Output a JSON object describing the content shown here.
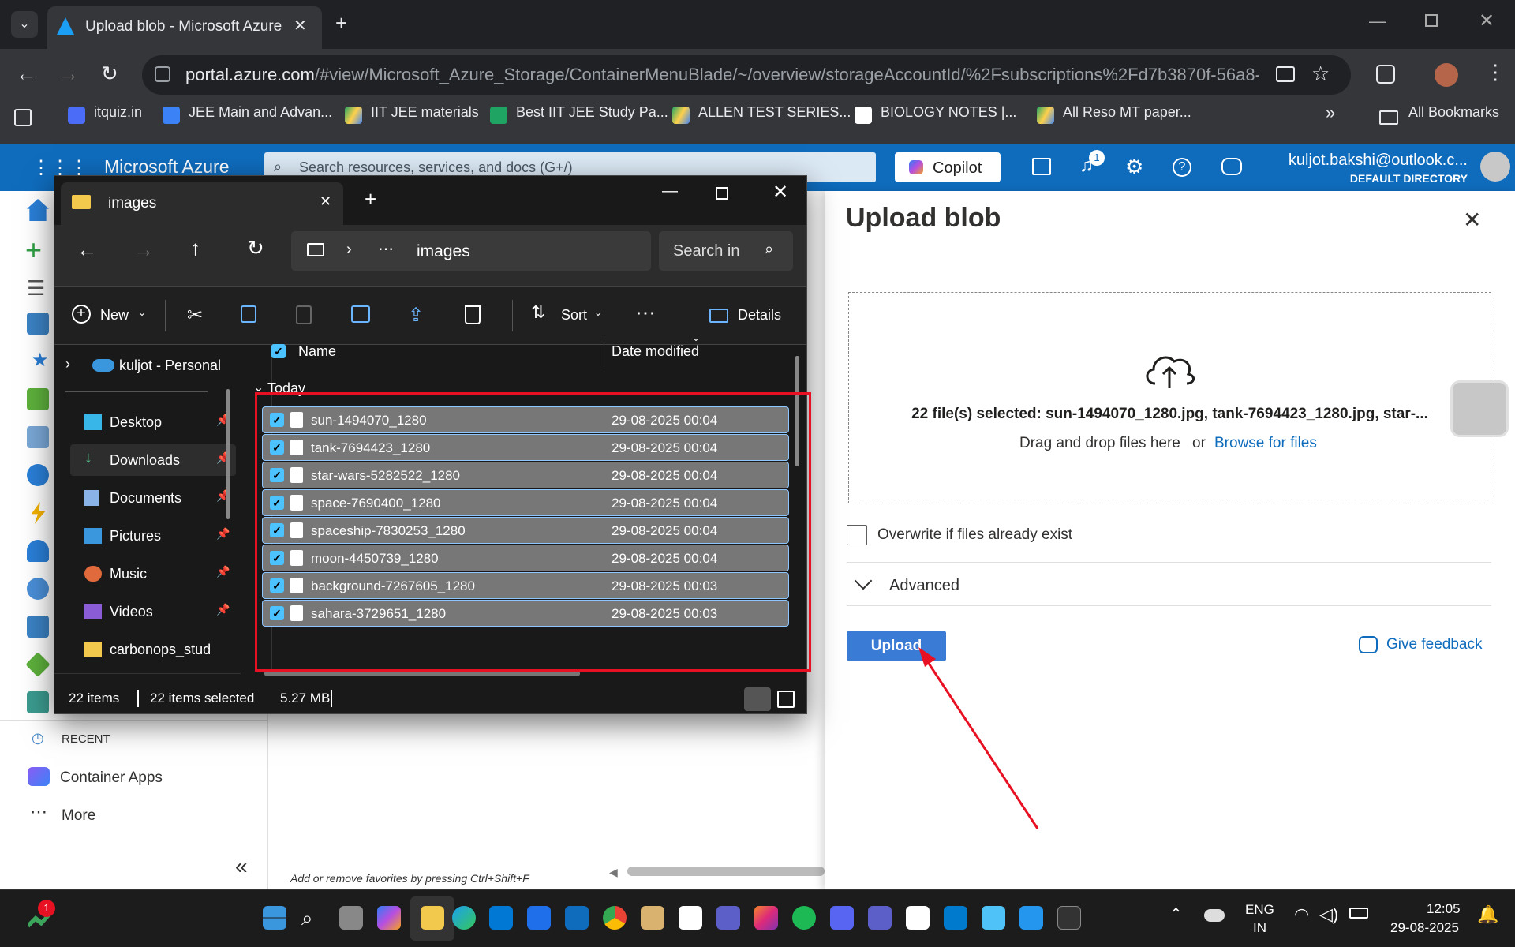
{
  "browser": {
    "tab_title": "Upload blob - Microsoft Azure",
    "url_host": "portal.azure.com",
    "url_path": "/#view/Microsoft_Azure_Storage/ContainerMenuBlade/~/overview/storageAccountId/%2Fsubscriptions%2Fd7b3870f-56a8-4d3b...",
    "bookmarks": [
      "itquiz.in",
      "JEE Main and Advan...",
      "IIT JEE materials",
      "Best IIT JEE Study Pa...",
      "ALLEN TEST SERIES...",
      "BIOLOGY NOTES |...",
      "All Reso MT paper..."
    ],
    "all_bookmarks": "All Bookmarks"
  },
  "azure": {
    "brand": "Microsoft Azure",
    "search_placeholder": "Search resources, services, and docs (G+/)",
    "copilot": "Copilot",
    "notif_count": "1",
    "user_email": "kuljot.bakshi@outlook.c...",
    "directory": "DEFAULT DIRECTORY",
    "recent_label": "RECENT",
    "container_apps": "Container Apps",
    "more": "More",
    "favorites_hint": "Add or remove favorites by pressing Ctrl+Shift+F"
  },
  "blade": {
    "title": "Upload blob",
    "selected_text": "22 file(s) selected: sun-1494070_1280.jpg, tank-7694423_1280.jpg, star-...",
    "drag_text": "Drag and drop files here",
    "or": "or",
    "browse": "Browse for files",
    "overwrite": "Overwrite if files already exist",
    "advanced": "Advanced",
    "upload": "Upload",
    "feedback": "Give feedback"
  },
  "explorer": {
    "tab": "images",
    "crumb": "images",
    "search_placeholder": "Search in",
    "new": "New",
    "sort": "Sort",
    "details": "Details",
    "col_name": "Name",
    "col_date": "Date modified",
    "group": "Today",
    "nav": [
      "kuljot - Personal",
      "Desktop",
      "Downloads",
      "Documents",
      "Pictures",
      "Music",
      "Videos",
      "carbonops_stud"
    ],
    "files": [
      {
        "name": "sun-1494070_1280",
        "date": "29-08-2025 00:04"
      },
      {
        "name": "tank-7694423_1280",
        "date": "29-08-2025 00:04"
      },
      {
        "name": "star-wars-5282522_1280",
        "date": "29-08-2025 00:04"
      },
      {
        "name": "space-7690400_1280",
        "date": "29-08-2025 00:04"
      },
      {
        "name": "spaceship-7830253_1280",
        "date": "29-08-2025 00:04"
      },
      {
        "name": "moon-4450739_1280",
        "date": "29-08-2025 00:04"
      },
      {
        "name": "background-7267605_1280",
        "date": "29-08-2025 00:03"
      },
      {
        "name": "sahara-3729651_1280",
        "date": "29-08-2025 00:03"
      }
    ],
    "status_items": "22 items",
    "status_selected": "22 items selected",
    "status_size": "5.27 MB"
  },
  "taskbar": {
    "lang1": "ENG",
    "lang2": "IN",
    "time": "12:05",
    "date": "29-08-2025",
    "badge": "1"
  },
  "colors": {
    "azure_blue": "#0f6cbd",
    "annotation_red": "#e81123",
    "explorer_bg": "#191919"
  }
}
